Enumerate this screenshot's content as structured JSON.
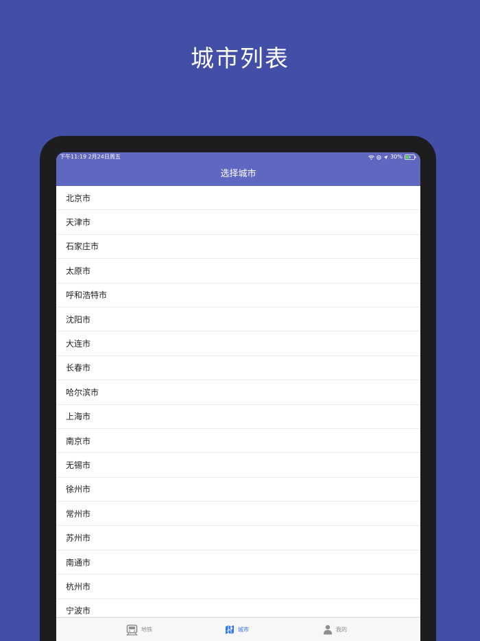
{
  "headline": "城市列表",
  "status_bar": {
    "time_date": "下午11:19   2月24日周五",
    "battery": "30%"
  },
  "nav": {
    "title": "选择城市"
  },
  "cities": [
    "北京市",
    "天津市",
    "石家庄市",
    "太原市",
    "呼和浩特市",
    "沈阳市",
    "大连市",
    "长春市",
    "哈尔滨市",
    "上海市",
    "南京市",
    "无锡市",
    "徐州市",
    "常州市",
    "苏州市",
    "南通市",
    "杭州市",
    "宁波市"
  ],
  "tabs": [
    {
      "label": "地铁",
      "icon": "subway-icon",
      "active": false
    },
    {
      "label": "城市",
      "icon": "city-map-icon",
      "active": true
    },
    {
      "label": "我的",
      "icon": "person-icon",
      "active": false
    }
  ],
  "colors": {
    "background": "#434fa6",
    "nav": "#5f67c1",
    "tab_active": "#3478f6",
    "tab_inactive": "#8e8e93"
  }
}
